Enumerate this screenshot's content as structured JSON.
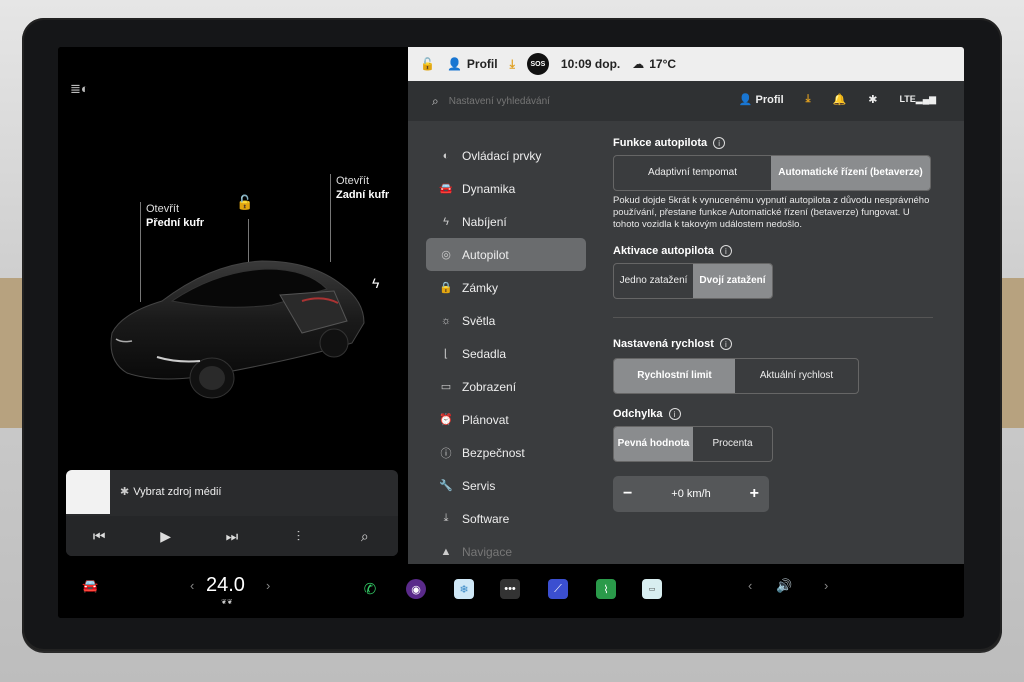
{
  "car_panel": {
    "frunk_line1": "Otevřít",
    "frunk_line2": "Přední kufr",
    "trunk_line1": "Otevřít",
    "trunk_line2": "Zadní kufr"
  },
  "media": {
    "title": "Vybrat zdroj médií"
  },
  "statusbar": {
    "profile": "Profil",
    "time": "10:09 dop.",
    "temperature": "17°C",
    "sos": "SOS"
  },
  "search": {
    "placeholder": "Nastavení vyhledávání",
    "profile": "Profil"
  },
  "menu": {
    "items": [
      {
        "label": "Ovládací prvky"
      },
      {
        "label": "Dynamika"
      },
      {
        "label": "Nabíjení"
      },
      {
        "label": "Autopilot"
      },
      {
        "label": "Zámky"
      },
      {
        "label": "Světla"
      },
      {
        "label": "Sedadla"
      },
      {
        "label": "Zobrazení"
      },
      {
        "label": "Plánovat"
      },
      {
        "label": "Bezpečnost"
      },
      {
        "label": "Servis"
      },
      {
        "label": "Software"
      },
      {
        "label": "Navigace"
      }
    ],
    "active": "Autopilot"
  },
  "autopilot": {
    "features_title": "Funkce autopilota",
    "opt_adaptive": "Adaptivní tempomat",
    "opt_autosteer": "Automatické řízení (betaverze)",
    "description": "Pokud dojde 5krát k vynucenému vypnutí autopilota z důvodu nesprávného používání, přestane funkce Automatické řízení (betaverze) fungovat. U tohoto vozidla k takovým událostem nedošlo.",
    "activation_title": "Aktivace autopilota",
    "opt_single": "Jedno zatažení",
    "opt_double": "Dvojí zatažení",
    "speed_title": "Nastavená rychlost",
    "opt_speed_limit": "Rychlostní limit",
    "opt_current_speed": "Aktuální rychlost",
    "offset_title": "Odchylka",
    "opt_fixed": "Pevná hodnota",
    "opt_percent": "Procenta",
    "offset_value": "+0 km/h"
  },
  "taskbar": {
    "temp_whole": "24.0"
  },
  "colors": {
    "accent_download": "#e0a020",
    "selected_segment": "#8a8c8e"
  }
}
